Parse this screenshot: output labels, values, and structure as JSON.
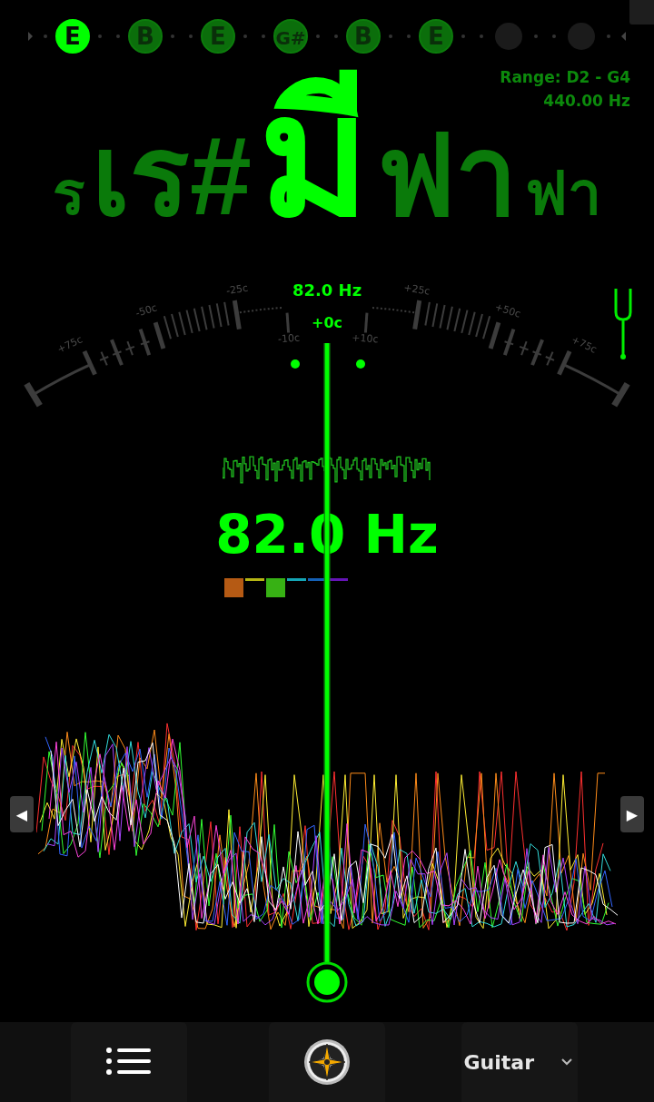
{
  "strings": [
    {
      "kind": "note",
      "label": "E",
      "selected": true
    },
    {
      "kind": "note",
      "label": "B",
      "selected": false
    },
    {
      "kind": "note",
      "label": "E",
      "selected": false
    },
    {
      "kind": "note",
      "label": "G#",
      "selected": false
    },
    {
      "kind": "note",
      "label": "B",
      "selected": false
    },
    {
      "kind": "note",
      "label": "E",
      "selected": false
    },
    {
      "kind": "empty",
      "selected": false
    },
    {
      "kind": "empty",
      "selected": false
    }
  ],
  "range": {
    "label": "Range: D2 - G4",
    "reference": "440.00 Hz"
  },
  "notes": [
    {
      "label": "ร",
      "selected": false
    },
    {
      "label": "เร#",
      "selected": false
    },
    {
      "label": "มี",
      "selected": true
    },
    {
      "label": "ฟา",
      "selected": false
    },
    {
      "label": "ฟา",
      "selected": false
    }
  ],
  "gauge": {
    "frequency": "82.0 Hz",
    "cents": "+0c",
    "labels": [
      "+75c",
      "-50c",
      "-25c",
      "-10c",
      "+10c",
      "+25c",
      "+50c",
      "+75c"
    ]
  },
  "frequency": "82.0 Hz",
  "harmonics": [
    {
      "color": "#b55a14",
      "kind": "block"
    },
    {
      "color": "#b5b514",
      "kind": "line"
    },
    {
      "color": "#37b114",
      "kind": "block"
    },
    {
      "color": "#14a5b5",
      "kind": "line"
    },
    {
      "color": "#1460b5",
      "kind": "line"
    },
    {
      "color": "#6414b5",
      "kind": "line"
    }
  ],
  "arrows": {
    "previous": "◀",
    "next": "▶"
  },
  "bottom_bar": {
    "instrument": "Guitar"
  }
}
